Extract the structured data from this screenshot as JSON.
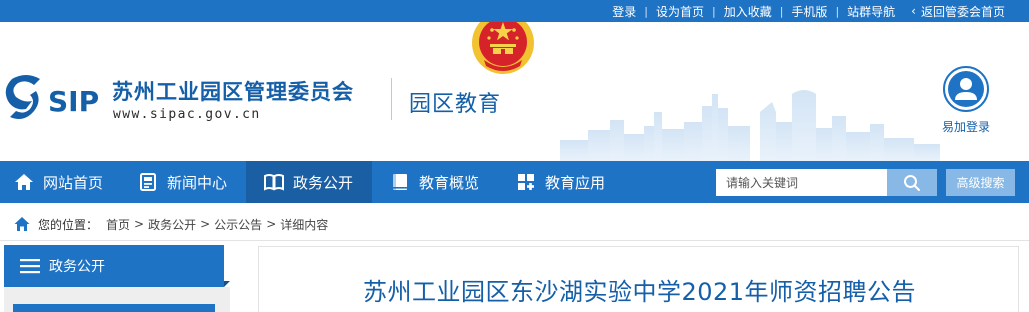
{
  "topbar": {
    "links": [
      "登录",
      "设为首页",
      "加入收藏",
      "手机版",
      "站群导航"
    ],
    "back_label": "返回管委会首页"
  },
  "header": {
    "logo_text": "SIP",
    "org_name": "苏州工业园区管理委员会",
    "org_url": "www.sipac.gov.cn",
    "section_title": "园区教育",
    "user_login_label": "易加登录"
  },
  "nav": {
    "items": [
      {
        "label": "网站首页",
        "icon": "home-icon"
      },
      {
        "label": "新闻中心",
        "icon": "news-icon"
      },
      {
        "label": "政务公开",
        "icon": "book-icon",
        "active": true
      },
      {
        "label": "教育概览",
        "icon": "notebook-icon"
      },
      {
        "label": "教育应用",
        "icon": "apps-icon"
      }
    ],
    "search_placeholder": "请输入关键词",
    "advanced_search_label": "高级搜索"
  },
  "breadcrumb": {
    "lead": "您的位置：",
    "items": [
      "首页",
      "政务公开",
      "公示公告",
      "详细内容"
    ]
  },
  "sidebar": {
    "title": "政务公开"
  },
  "article": {
    "title": "苏州工业园区东沙湖实验中学2021年师资招聘公告"
  },
  "colors": {
    "brand_blue": "#1f73c4",
    "nav_active": "#1a5fa4",
    "title_blue": "#155fa8",
    "search_button": "#87b8e6",
    "emblem_red": "#d6232a",
    "emblem_gold": "#f2c230"
  }
}
